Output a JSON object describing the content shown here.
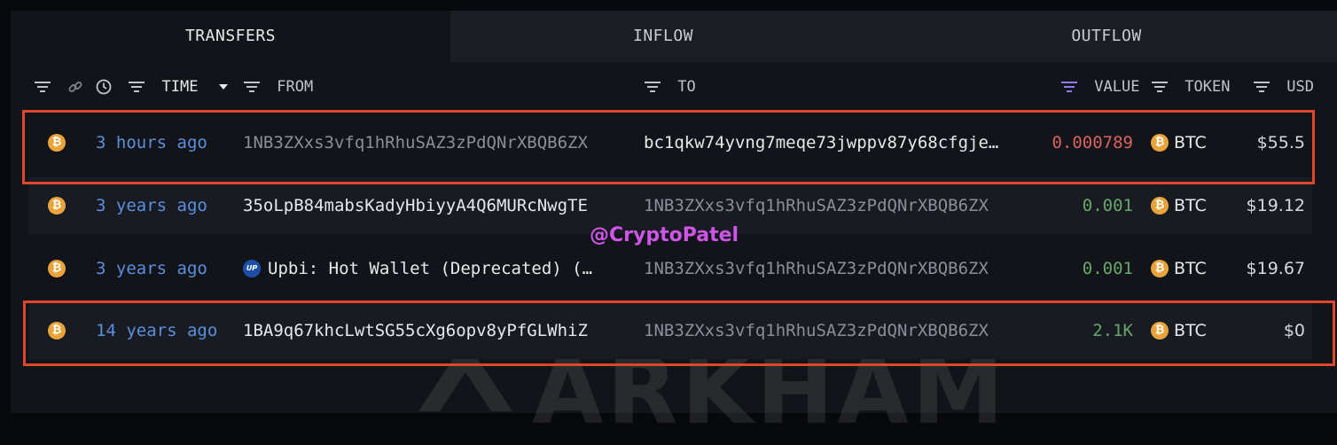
{
  "tabs": [
    {
      "label": "TRANSFERS",
      "active": true
    },
    {
      "label": "INFLOW",
      "active": false
    },
    {
      "label": "OUTFLOW",
      "active": false
    }
  ],
  "columns": {
    "time": "TIME",
    "from": "FROM",
    "to": "TO",
    "value": "VALUE",
    "token": "TOKEN",
    "usd": "USD"
  },
  "rows": [
    {
      "time": "3 hours ago",
      "from": "1NB3ZXxs3vfq1hRhuSAZ3zPdQNrXBQB6ZX",
      "to": "bc1qkw74yvng7meqe73jwppv87y68cfgje…",
      "value": "0.000789",
      "token": "BTC",
      "usd": "$55.5"
    },
    {
      "time": "3 years ago",
      "from": "35oLpB84mabsKadyHbiyyA4Q6MURcNwgTE",
      "to": "1NB3ZXxs3vfq1hRhuSAZ3zPdQNrXBQB6ZX",
      "value": "0.001",
      "token": "BTC",
      "usd": "$19.12"
    },
    {
      "time": "3 years ago",
      "from": "Upbi: Hot Wallet (Deprecated) (…",
      "from_badge": "UP",
      "to": "1NB3ZXxs3vfq1hRhuSAZ3zPdQNrXBQB6ZX",
      "value": "0.001",
      "token": "BTC",
      "usd": "$19.67"
    },
    {
      "time": "14 years ago",
      "from": "1BA9q67khcLwtSG55cXg6opv8yPfGLWhiZ",
      "to": "1NB3ZXxs3vfq1hRhuSAZ3zPdQNrXBQB6ZX",
      "value": "2.1K",
      "token": "BTC",
      "usd": "$0"
    }
  ],
  "coin_symbol": "₿",
  "watermarks": {
    "handle": "@CryptoPatel",
    "brand": "ARKHAM"
  },
  "colors": {
    "time": "#5b8fdc",
    "value_negative": "#d7645e",
    "value_positive": "#67a86a",
    "highlight": "#e0452d",
    "btc": "#e8a33a"
  }
}
